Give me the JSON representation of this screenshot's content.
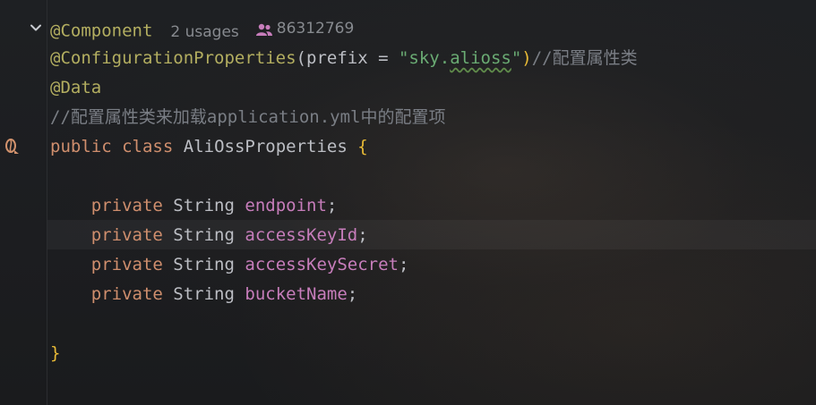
{
  "editor": {
    "inlay": {
      "usages": "2 usages",
      "author": "86312769"
    },
    "lines": {
      "l1_annotation": "@Component",
      "l2_annotation": "@ConfigurationProperties",
      "l2_open": "(",
      "l2_param": "prefix",
      "l2_eq": " = ",
      "l2_quote_open": "\"",
      "l2_str_a": "sky.",
      "l2_str_b": "alioss",
      "l2_quote_close": "\"",
      "l2_close": ")",
      "l2_comment": "//配置属性类",
      "l3_annotation": "@Data",
      "l4_comment": "//配置属性类来加载application.yml中的配置项",
      "l5_public": "public",
      "l5_class": "class",
      "l5_name": "AliOssProperties",
      "l5_brace": "{",
      "f1_kw": "private",
      "f1_type": "String",
      "f1_name": "endpoint",
      "f2_kw": "private",
      "f2_type": "String",
      "f2_name": "accessKeyId",
      "f3_kw": "private",
      "f3_type": "String",
      "f3_name": "accessKeySecret",
      "f4_kw": "private",
      "f4_type": "String",
      "f4_name": "bucketName",
      "semicolon": ";",
      "close_brace": "}"
    },
    "icons": {
      "fold": "chevron-down-icon",
      "bean": "spring-bean-icon",
      "users": "users-icon"
    },
    "colors": {
      "annotation": "#b3ae60",
      "keyword": "#cf8e6d",
      "field": "#c77dbb",
      "string": "#6aab73",
      "comment": "#7a7e85",
      "brace": "#e8ba36",
      "users_icon": "#c77dbb"
    }
  }
}
